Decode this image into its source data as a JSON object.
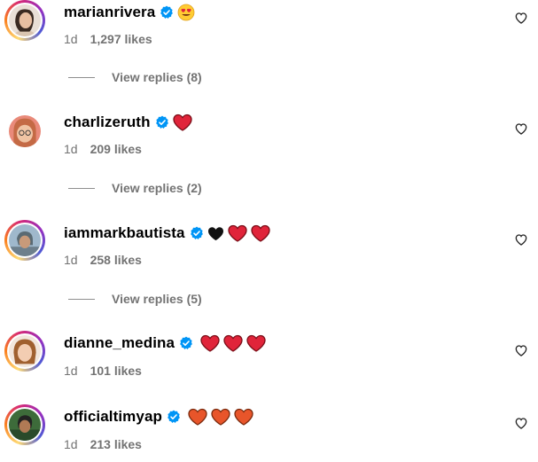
{
  "comments": [
    {
      "username": "marianrivera",
      "time": "1d",
      "likes": "1,297 likes",
      "emojis": [
        "heart-eyes"
      ],
      "replies": "View replies (8)"
    },
    {
      "username": "charlizeruth",
      "time": "1d",
      "likes": "209 likes",
      "emojis": [
        "red-heart"
      ],
      "replies": "View replies (2)"
    },
    {
      "username": "iammarkbautista",
      "time": "1d",
      "likes": "258 likes",
      "emojis": [
        "black-heart",
        "red-heart",
        "red-heart"
      ],
      "replies": "View replies (5)"
    },
    {
      "username": "dianne_medina",
      "time": "1d",
      "likes": "101 likes",
      "emojis": [
        "red-heart",
        "red-heart",
        "red-heart"
      ]
    },
    {
      "username": "officialtimyap",
      "time": "1d",
      "likes": "213 likes",
      "emojis": [
        "orange-heart",
        "orange-heart",
        "orange-heart"
      ]
    }
  ],
  "colors": {
    "verified": "#0095f6",
    "meta_text": "#737373",
    "red_heart": "#e0243a",
    "orange_heart": "#e8552a",
    "black_heart": "#111111"
  },
  "icons": {
    "verified": "verified-badge-icon",
    "like": "heart-outline-icon"
  }
}
